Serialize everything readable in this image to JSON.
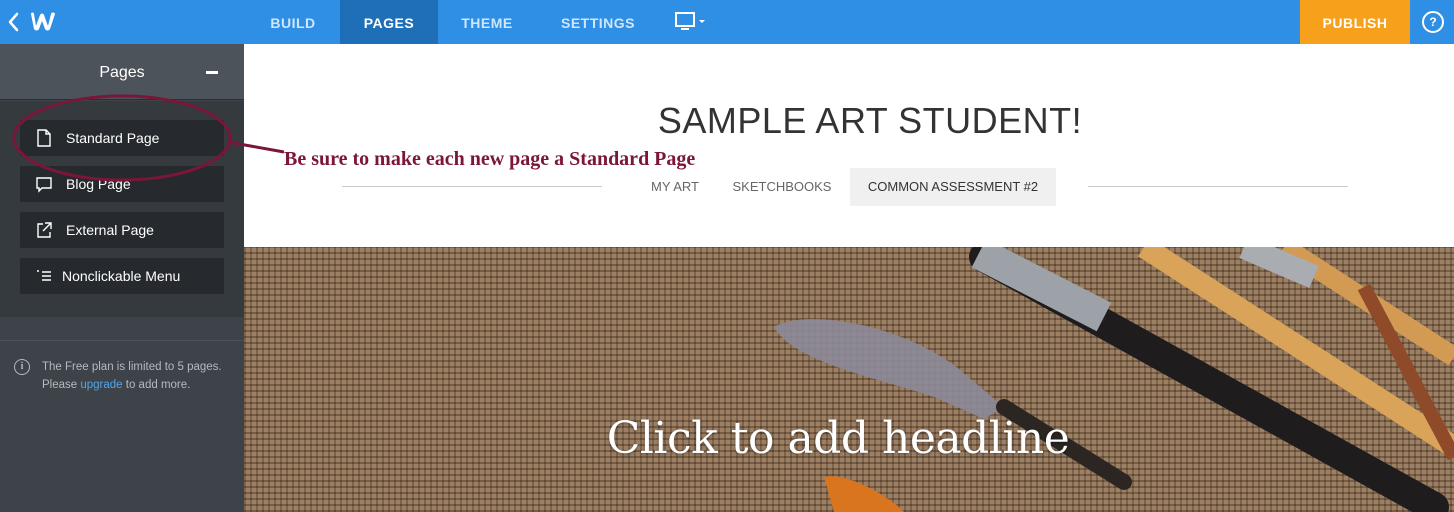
{
  "topbar": {
    "tabs": [
      {
        "label": "BUILD"
      },
      {
        "label": "PAGES"
      },
      {
        "label": "THEME"
      },
      {
        "label": "SETTINGS"
      }
    ],
    "publish_label": "PUBLISH",
    "help_label": "?",
    "active_tab": "PAGES",
    "colors": {
      "bar": "#2f8fe4",
      "active": "#1e6fb8",
      "publish": "#f7a01b"
    }
  },
  "sidebar": {
    "title": "Pages",
    "page_types": [
      {
        "label": "Standard Page",
        "icon": "document-icon"
      },
      {
        "label": "Blog Page",
        "icon": "comment-icon"
      },
      {
        "label": "External Page",
        "icon": "external-link-icon"
      },
      {
        "label": "Nonclickable Menu",
        "icon": "menu-list-icon"
      }
    ],
    "note_before": "The Free plan is limited to 5 pages. Please ",
    "note_link": "upgrade",
    "note_after": " to add more."
  },
  "site": {
    "title": "SAMPLE ART STUDENT!",
    "nav": [
      {
        "label": "MY ART"
      },
      {
        "label": "SKETCHBOOKS"
      },
      {
        "label": "COMMON ASSESSMENT #2"
      }
    ],
    "headline": "Click to add headline"
  },
  "annotation": {
    "text": "Be sure to make each new page a Standard Page",
    "color": "#7a1637"
  }
}
